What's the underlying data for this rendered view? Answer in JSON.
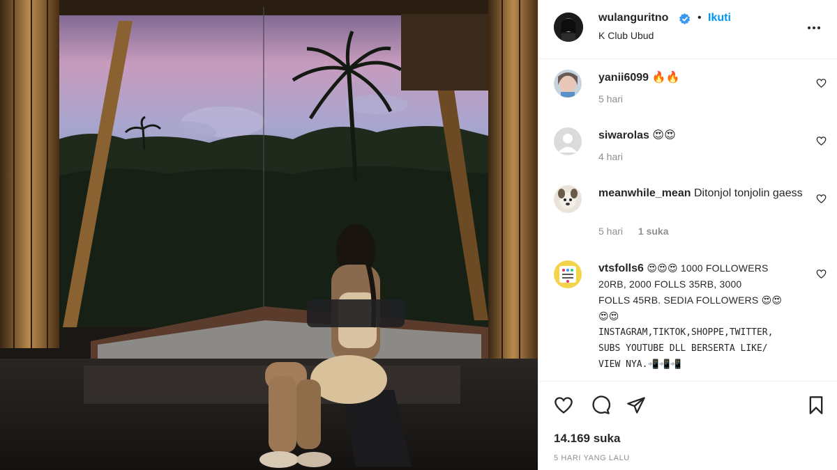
{
  "post": {
    "username": "wulanguritno",
    "dot": "•",
    "follow_label": "Ikuti",
    "location": "K Club Ubud"
  },
  "comments": [
    {
      "username": "yanii6099",
      "text": "🔥🔥",
      "time": "5 hari",
      "likes": ""
    },
    {
      "username": "siwarolas",
      "text": "😍😍",
      "time": "4 hari",
      "likes": ""
    },
    {
      "username": "meanwhile_mean",
      "text": "Ditonjol tonjolin gaess",
      "time": "5 hari",
      "likes": "1 suka"
    },
    {
      "username": "vtsfolls6",
      "text_line1": "😍😍😍 1000 FOLLOWERS",
      "text_line2": "20RB, 2000 FOLLS 35RB, 3000",
      "text_line3": "FOLLS 45RB. SEDIA FOLLOWERS 😍😍",
      "text_line4": "😍😍",
      "text_line5": "INSTAGRAM,TIKTOK,SHOPPE,TWITTER,",
      "text_line6": "SUBS YOUTUBE DLL BERSERTA LIKE/",
      "text_line7": "VIEW NYA.📲📲📲"
    }
  ],
  "actions": {
    "like_count": "14.169 suka",
    "timestamp": "5 HARI YANG LALU"
  },
  "icons": {
    "verified": "verified-badge-icon",
    "more": "more-options-icon",
    "like": "heart-icon",
    "comment": "comment-bubble-icon",
    "share": "paper-plane-icon",
    "save": "bookmark-icon"
  },
  "colors": {
    "accent": "#0095f6",
    "text": "#262626",
    "muted": "#8e8e8e",
    "verified": "#3897f0"
  }
}
